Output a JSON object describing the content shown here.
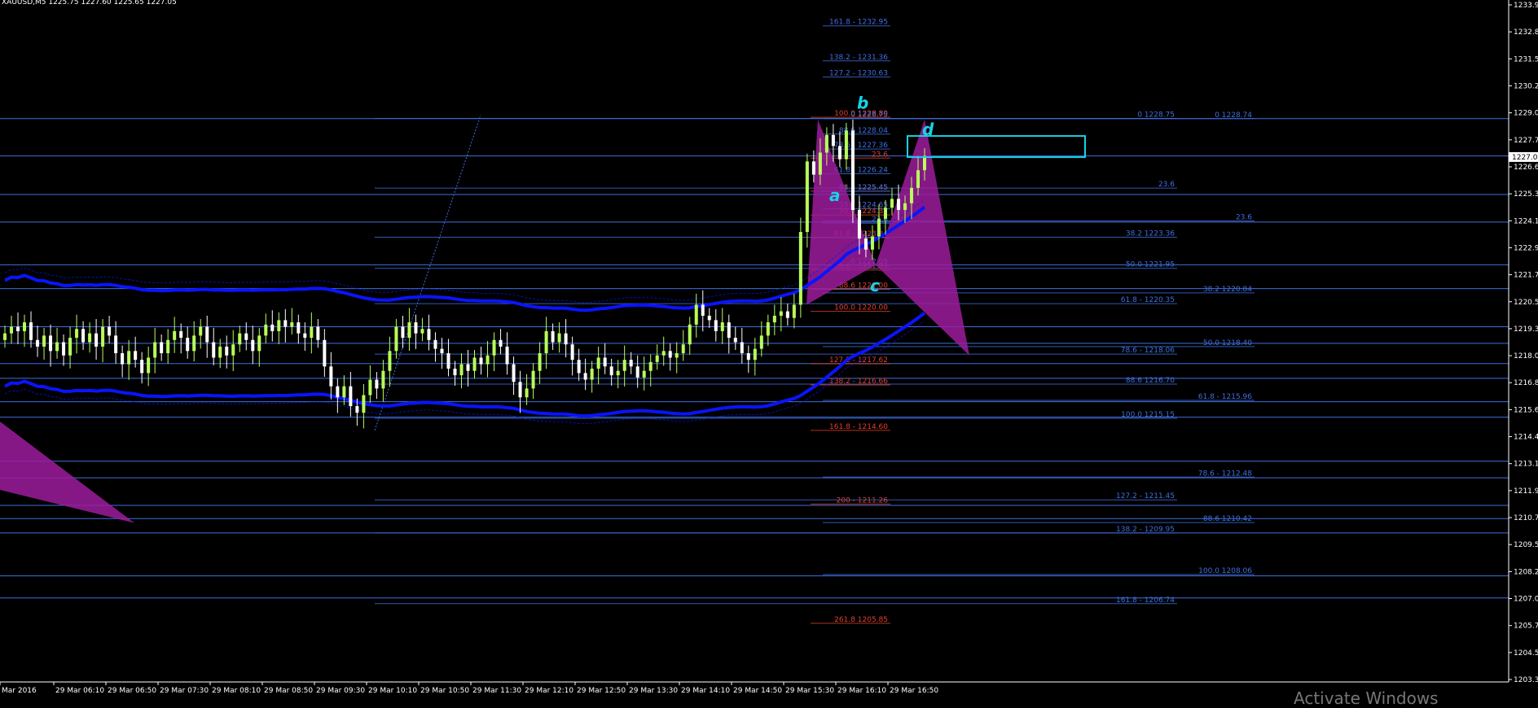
{
  "header": {
    "symbol_line": "XAUUSD,M5  1225.75 1227.60 1225.65 1227.05"
  },
  "watermark": "Activate Windows",
  "colors": {
    "background": "#000000",
    "axis": "#ffffff",
    "fib_blue": "#3f6fe0",
    "fib_red": "#e0402a",
    "moving_average": "#0a14ff",
    "pattern": "#9c1c9c",
    "pattern_label": "#18d2e6",
    "candle_up": "#b8ff5a",
    "candle_down": "#ffffff",
    "target_box": "#18d2e6"
  },
  "chart_data": {
    "type": "candlestick",
    "ylim": [
      1203.3,
      1233.9
    ],
    "y_ticks": [
      "1233.9",
      "1232.8",
      "1231.5",
      "1230.2",
      "1229.0",
      "1227.7",
      "1226.6",
      "1225.3",
      "1224.1",
      "1222.9",
      "1221.7",
      "1220.5",
      "1219.3",
      "1218.0",
      "1216.8",
      "1215.6",
      "1214.4",
      "1213.1",
      "1211.9",
      "1210.7",
      "1209.5",
      "1208.2",
      "1207.0",
      "1205.7",
      "1204.5",
      "1203.3"
    ],
    "x_labels": [
      "Mar 2016",
      "29 Mar 06:10",
      "29 Mar 06:50",
      "29 Mar 07:30",
      "29 Mar 08:10",
      "29 Mar 08:50",
      "29 Mar 09:30",
      "29 Mar 10:10",
      "29 Mar 10:50",
      "29 Mar 11:30",
      "29 Mar 12:10",
      "29 Mar 12:50",
      "29 Mar 13:30",
      "29 Mar 14:10",
      "29 Mar 14:50",
      "29 Mar 15:30",
      "29 Mar 16:10",
      "29 Mar 16:50"
    ],
    "current_price": "1227.0",
    "candles_close": [
      1219.0,
      1219.3,
      1219.1,
      1219.5,
      1218.7,
      1218.4,
      1218.9,
      1218.2,
      1218.6,
      1218.0,
      1218.8,
      1219.2,
      1218.6,
      1219.0,
      1218.4,
      1219.3,
      1218.9,
      1218.1,
      1217.6,
      1218.2,
      1217.8,
      1217.2,
      1217.9,
      1218.6,
      1218.1,
      1218.7,
      1219.1,
      1218.8,
      1218.2,
      1218.9,
      1219.3,
      1218.6,
      1217.9,
      1218.4,
      1218.0,
      1218.5,
      1219.0,
      1218.7,
      1218.2,
      1218.9,
      1219.4,
      1219.1,
      1219.6,
      1219.3,
      1219.5,
      1219.0,
      1218.8,
      1219.3,
      1218.7,
      1217.5,
      1216.6,
      1216.1,
      1216.6,
      1215.7,
      1215.4,
      1216.2,
      1216.9,
      1216.5,
      1217.3,
      1218.2,
      1219.3,
      1218.8,
      1219.5,
      1219.0,
      1219.2,
      1218.7,
      1218.3,
      1218.1,
      1217.4,
      1217.1,
      1217.6,
      1217.3,
      1217.9,
      1217.6,
      1218.0,
      1218.7,
      1218.4,
      1217.6,
      1216.8,
      1216.1,
      1216.5,
      1217.3,
      1218.1,
      1219.1,
      1218.6,
      1219.0,
      1218.5,
      1217.8,
      1217.2,
      1216.9,
      1217.4,
      1217.9,
      1217.5,
      1217.1,
      1217.3,
      1217.8,
      1217.5,
      1217.0,
      1217.3,
      1217.7,
      1218.0,
      1218.2,
      1217.9,
      1218.1,
      1218.5,
      1219.4,
      1220.3,
      1219.8,
      1219.6,
      1219.1,
      1219.5,
      1218.8,
      1218.6,
      1218.1,
      1217.8,
      1218.3,
      1218.9,
      1219.5,
      1219.8,
      1220.0,
      1219.7,
      1220.3,
      1223.6,
      1226.8,
      1226.2,
      1227.2,
      1228.0,
      1227.5,
      1226.9,
      1228.2,
      1224.6,
      1223.3,
      1222.8,
      1223.4,
      1224.2,
      1224.7,
      1225.1,
      1224.6,
      1224.9,
      1225.6,
      1226.4,
      1227.05
    ],
    "pattern_points": {
      "X": 1220.3,
      "A": 1228.7,
      "B": 1222.1,
      "C": 1228.7,
      "D": 1218.0
    },
    "pattern_labels": [
      "a",
      "b",
      "c",
      "d"
    ],
    "horizontal_levels": [
      1228.74,
      1227.05,
      1225.3,
      1224.05,
      1222.11,
      1221.03,
      1219.3,
      1218.55,
      1217.63,
      1216.96,
      1215.9,
      1215.2,
      1213.2,
      1212.45,
      1211.2,
      1210.6,
      1209.95,
      1208.0,
      1207.0
    ],
    "fib_labels": [
      {
        "text": "161.8 - 1232.95",
        "price": 1232.95,
        "color": "blue",
        "right": 1088
      },
      {
        "text": "138.2 - 1231.36",
        "price": 1231.36,
        "color": "blue",
        "right": 1088
      },
      {
        "text": "127.2 - 1230.63",
        "price": 1230.63,
        "color": "blue",
        "right": 1088
      },
      {
        "text": "100.0 1228.80",
        "price": 1228.8,
        "color": "red",
        "right": 1088
      },
      {
        "text": "0 1228.75",
        "price": 1228.75,
        "color": "blue",
        "right": 1088
      },
      {
        "text": "88.6 1228.04",
        "price": 1228.04,
        "color": "blue",
        "right": 1088
      },
      {
        "text": "78.6 - 1227.36",
        "price": 1227.36,
        "color": "blue",
        "right": 1088
      },
      {
        "text": "23.6",
        "price": 1226.95,
        "color": "red",
        "right": 1088
      },
      {
        "text": "61.8 - 1226.24",
        "price": 1226.24,
        "color": "blue",
        "right": 1088
      },
      {
        "text": "38.2 1225.45",
        "price": 1225.45,
        "color": "red",
        "right": 1088
      },
      {
        "text": "61.8 1225.45",
        "price": 1225.45,
        "color": "blue",
        "right": 1088
      },
      {
        "text": "38.2 1224.65",
        "price": 1224.65,
        "color": "blue",
        "right": 1088
      },
      {
        "text": "50.0 1224.37",
        "price": 1224.37,
        "color": "red",
        "right": 1088
      },
      {
        "text": "23.6",
        "price": 1224.0,
        "color": "blue",
        "right": 1088
      },
      {
        "text": "61.8 - 1223.34",
        "price": 1223.34,
        "color": "red",
        "right": 1088
      },
      {
        "text": "0 1222.09",
        "price": 1222.09,
        "color": "blue",
        "right": 1088
      },
      {
        "text": "78.6 - 1221.87",
        "price": 1221.87,
        "color": "red",
        "right": 1088
      },
      {
        "text": "88.6 1221.00",
        "price": 1221.0,
        "color": "red",
        "right": 1088
      },
      {
        "text": "100.0 1220.00",
        "price": 1220.0,
        "color": "red",
        "right": 1088
      },
      {
        "text": "127.2 - 1217.62",
        "price": 1217.62,
        "color": "red",
        "right": 1088
      },
      {
        "text": "138.2 - 1216.66",
        "price": 1216.66,
        "color": "red",
        "right": 1088
      },
      {
        "text": "161.8 - 1214.60",
        "price": 1214.6,
        "color": "red",
        "right": 1088
      },
      {
        "text": "200 - 1211.26",
        "price": 1211.26,
        "color": "red",
        "right": 1088
      },
      {
        "text": "261.8 1205.85",
        "price": 1205.85,
        "color": "red",
        "right": 1088
      },
      {
        "text": "0 1228.75",
        "price": 1228.75,
        "color": "blue",
        "right": 1440
      },
      {
        "text": "23.6",
        "price": 1225.59,
        "color": "blue",
        "right": 1440
      },
      {
        "text": "38.2 1223.36",
        "price": 1223.36,
        "color": "blue",
        "right": 1440
      },
      {
        "text": "50.0 1221.95",
        "price": 1221.95,
        "color": "blue",
        "right": 1440
      },
      {
        "text": "61.8 - 1220.35",
        "price": 1220.35,
        "color": "blue",
        "right": 1440
      },
      {
        "text": "78.6 - 1218.06",
        "price": 1218.06,
        "color": "blue",
        "right": 1440
      },
      {
        "text": "88.6 1216.70",
        "price": 1216.7,
        "color": "blue",
        "right": 1440
      },
      {
        "text": "100.0 1215.15",
        "price": 1215.15,
        "color": "blue",
        "right": 1440
      },
      {
        "text": "127.2 - 1211.45",
        "price": 1211.45,
        "color": "blue",
        "right": 1440
      },
      {
        "text": "138.2 - 1209.95",
        "price": 1209.95,
        "color": "blue",
        "right": 1440
      },
      {
        "text": "161.8 - 1206.74",
        "price": 1206.74,
        "color": "blue",
        "right": 1440
      },
      {
        "text": "0 1228.74",
        "price": 1228.74,
        "color": "blue",
        "right": 1535
      },
      {
        "text": "23.6",
        "price": 1224.1,
        "color": "blue",
        "right": 1535
      },
      {
        "text": "38.2 1220.84",
        "price": 1220.84,
        "color": "blue",
        "right": 1535
      },
      {
        "text": "50.0 1218.40",
        "price": 1218.4,
        "color": "blue",
        "right": 1535
      },
      {
        "text": "61.8 - 1215.96",
        "price": 1215.96,
        "color": "blue",
        "right": 1535
      },
      {
        "text": "78.6 - 1212.48",
        "price": 1212.48,
        "color": "blue",
        "right": 1535
      },
      {
        "text": "88.6 1210.42",
        "price": 1210.42,
        "color": "blue",
        "right": 1535
      },
      {
        "text": "100.0 1208.06",
        "price": 1208.06,
        "color": "blue",
        "right": 1535
      }
    ]
  }
}
